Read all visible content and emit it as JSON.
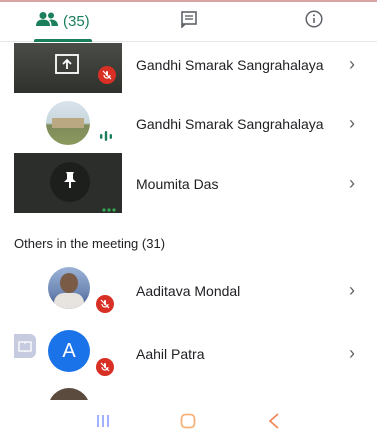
{
  "tabs": [
    {
      "label": "(35)",
      "icon": "people-icon",
      "active": true
    },
    {
      "label": "",
      "icon": "chat-icon",
      "active": false
    },
    {
      "label": "",
      "icon": "info-icon",
      "active": false
    }
  ],
  "participants": [
    {
      "name": "Gandhi Smarak Sangrahalaya",
      "tile": "presenting-screen",
      "status_icon": "mic-off-icon"
    },
    {
      "name": "Gandhi Smarak Sangrahalaya",
      "tile": "video-avatar",
      "status_icon": "audio-level-icon"
    },
    {
      "name": "Moumita Das",
      "tile": "pinned-avatar",
      "status_icon": "more-dots-icon"
    }
  ],
  "others_label": "Others in the meeting (31)",
  "others": [
    {
      "name": "Aaditava Mondal",
      "avatar": "photo",
      "status_icon": "mic-off-icon"
    },
    {
      "name": "Aahil Patra",
      "avatar_letter": "A",
      "status_icon": "mic-off-icon"
    }
  ],
  "colors": {
    "accent": "#1a7f5a",
    "tile_dark": "#2b2e2b",
    "mic_off_red": "#d93025",
    "avatar_blue": "#1a73e8",
    "nav_icon": "#a3b0ff",
    "home_orange": "#f5b37a",
    "back_orange": "#f08a5d"
  },
  "nav": [
    "recent-apps-icon",
    "home-icon",
    "back-icon"
  ]
}
